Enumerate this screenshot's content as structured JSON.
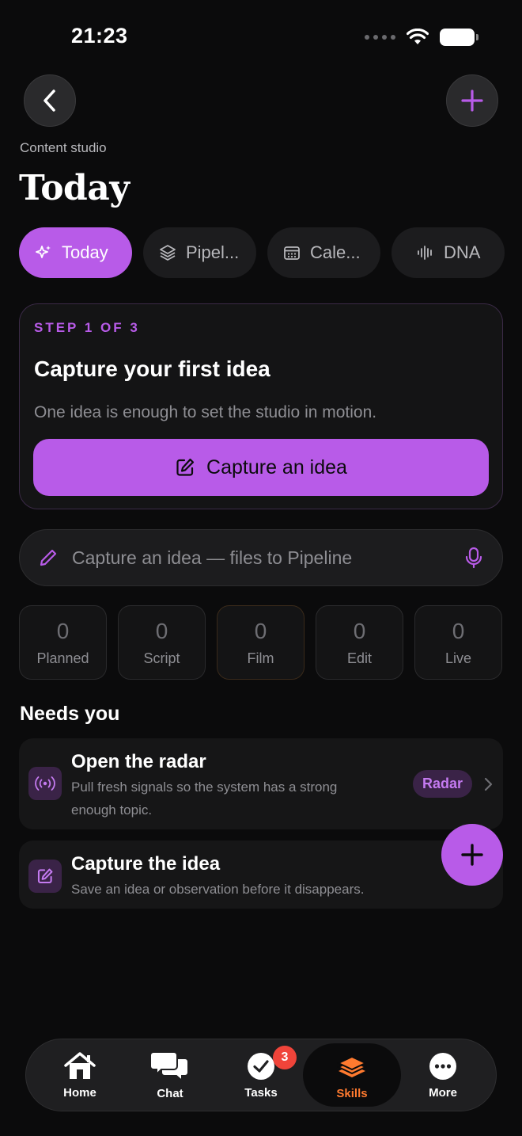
{
  "status_bar": {
    "time": "21:23"
  },
  "header": {
    "eyebrow": "Content studio",
    "title": "Today"
  },
  "tabs": [
    {
      "label": "Today",
      "icon": "sparkle-icon",
      "active": true
    },
    {
      "label": "Pipel...",
      "icon": "layers-icon",
      "active": false
    },
    {
      "label": "Cale...",
      "icon": "calendar-icon",
      "active": false
    },
    {
      "label": "DNA",
      "icon": "waveform-icon",
      "active": false
    }
  ],
  "step_card": {
    "step_label": "STEP 1 OF 3",
    "title": "Capture your first idea",
    "description": "One idea is enough to set the studio in motion.",
    "button_label": "Capture an idea"
  },
  "capture_input": {
    "placeholder": "Capture an idea — files to Pipeline",
    "value": ""
  },
  "stats": [
    {
      "value": "0",
      "label": "Planned"
    },
    {
      "value": "0",
      "label": "Script"
    },
    {
      "value": "0",
      "label": "Film"
    },
    {
      "value": "0",
      "label": "Edit"
    },
    {
      "value": "0",
      "label": "Live"
    }
  ],
  "needs_you": {
    "title": "Needs you",
    "items": [
      {
        "title": "Open the radar",
        "description_line1": "Pull fresh signals so the system has a strong",
        "description_line2": "enough topic.",
        "pill": "Radar",
        "icon": "radar-icon"
      },
      {
        "title": "Capture the idea",
        "description": "Save an idea or observation before it disappears.",
        "icon": "edit-icon"
      }
    ]
  },
  "bottom_nav": {
    "items": [
      {
        "label": "Home",
        "icon": "home-icon"
      },
      {
        "label": "Chat",
        "icon": "chat-icon"
      },
      {
        "label": "Tasks",
        "icon": "check-circle-icon",
        "badge": "3"
      },
      {
        "label": "Skills",
        "icon": "stack-icon",
        "active": true
      },
      {
        "label": "More",
        "icon": "more-icon"
      }
    ]
  },
  "colors": {
    "accent": "#b85be8",
    "background": "#0b0b0c",
    "nav_active": "#ff7a2f",
    "badge": "#f0443a"
  }
}
